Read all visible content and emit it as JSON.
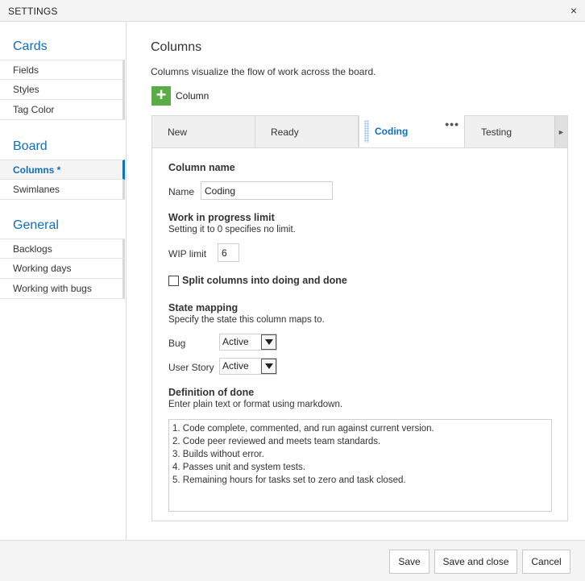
{
  "window": {
    "title": "SETTINGS",
    "close_icon": "×"
  },
  "nav": {
    "sections": [
      {
        "title": "Cards",
        "items": [
          "Fields",
          "Styles",
          "Tag Color"
        ]
      },
      {
        "title": "Board",
        "items": [
          "Columns *",
          "Swimlanes"
        ]
      },
      {
        "title": "General",
        "items": [
          "Backlogs",
          "Working days",
          "Working with bugs"
        ]
      }
    ],
    "active_item": "Columns *"
  },
  "main": {
    "heading": "Columns",
    "subtitle": "Columns visualize the flow of work across the board.",
    "add_column": {
      "icon": "plus-icon",
      "label": "Column"
    },
    "tabs": [
      {
        "label": "New"
      },
      {
        "label": "Ready"
      },
      {
        "label": "Coding",
        "active": true
      },
      {
        "label": "Testing"
      }
    ],
    "tab_more_icon": "•••",
    "tab_scroll_icon": "►",
    "form": {
      "column_name_heading": "Column name",
      "name_label": "Name",
      "name_value": "Coding",
      "wip_heading": "Work in progress limit",
      "wip_help": "Setting it to 0 specifies no limit.",
      "wip_label": "WIP limit",
      "wip_value": "6",
      "split_label": "Split columns into doing and done",
      "split_checked": false,
      "state_heading": "State mapping",
      "state_help": "Specify the state this column maps to.",
      "bug_label": "Bug",
      "bug_value": "Active",
      "story_label": "User Story",
      "story_value": "Active",
      "dod_heading": "Definition of done",
      "dod_help": "Enter plain text or format using markdown.",
      "dod_lines": [
        "1.  Code complete, commented, and run against current version.",
        "2.  Code peer reviewed and meets team standards.",
        "3.  Builds without error.",
        "4.  Passes unit and system tests.",
        "5.  Remaining hours for tasks set to zero and task closed."
      ]
    }
  },
  "footer": {
    "save": "Save",
    "save_close": "Save and close",
    "cancel": "Cancel"
  },
  "colors": {
    "accent": "#106ebe",
    "add_green": "#5aac44"
  }
}
